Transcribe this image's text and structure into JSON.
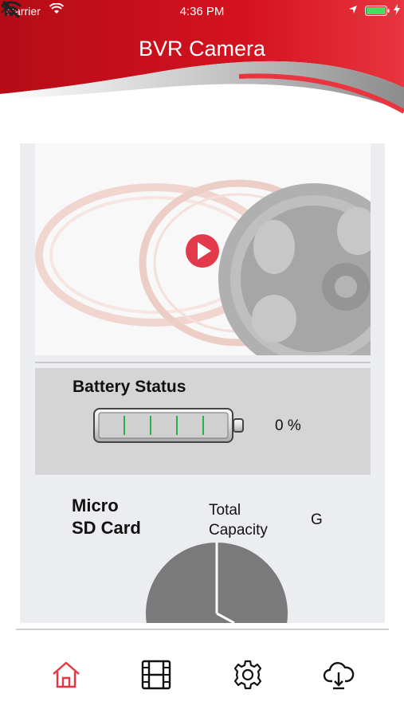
{
  "status_bar": {
    "carrier": "Carrier",
    "time": "4:36 PM"
  },
  "header": {
    "title": "BVR Camera",
    "icons": [
      "bluetooth-icon",
      "wifi-off-icon"
    ]
  },
  "video": {
    "play_icon": "play-icon"
  },
  "battery": {
    "title": "Battery Status",
    "percent_text": "0 %",
    "level": 0
  },
  "sd_card": {
    "title_line1": "Micro",
    "title_line2": "SD Card",
    "capacity_line1": "Total",
    "capacity_line2": "Capacity",
    "capacity_value": "G"
  },
  "tab_bar": {
    "tabs": [
      "home-icon",
      "film-icon",
      "settings-icon",
      "cloud-download-icon"
    ],
    "active": "home-icon"
  },
  "colors": {
    "brand_red": "#c8101e",
    "accent_red": "#e8353f",
    "pie_gray": "#7a7a7a"
  }
}
